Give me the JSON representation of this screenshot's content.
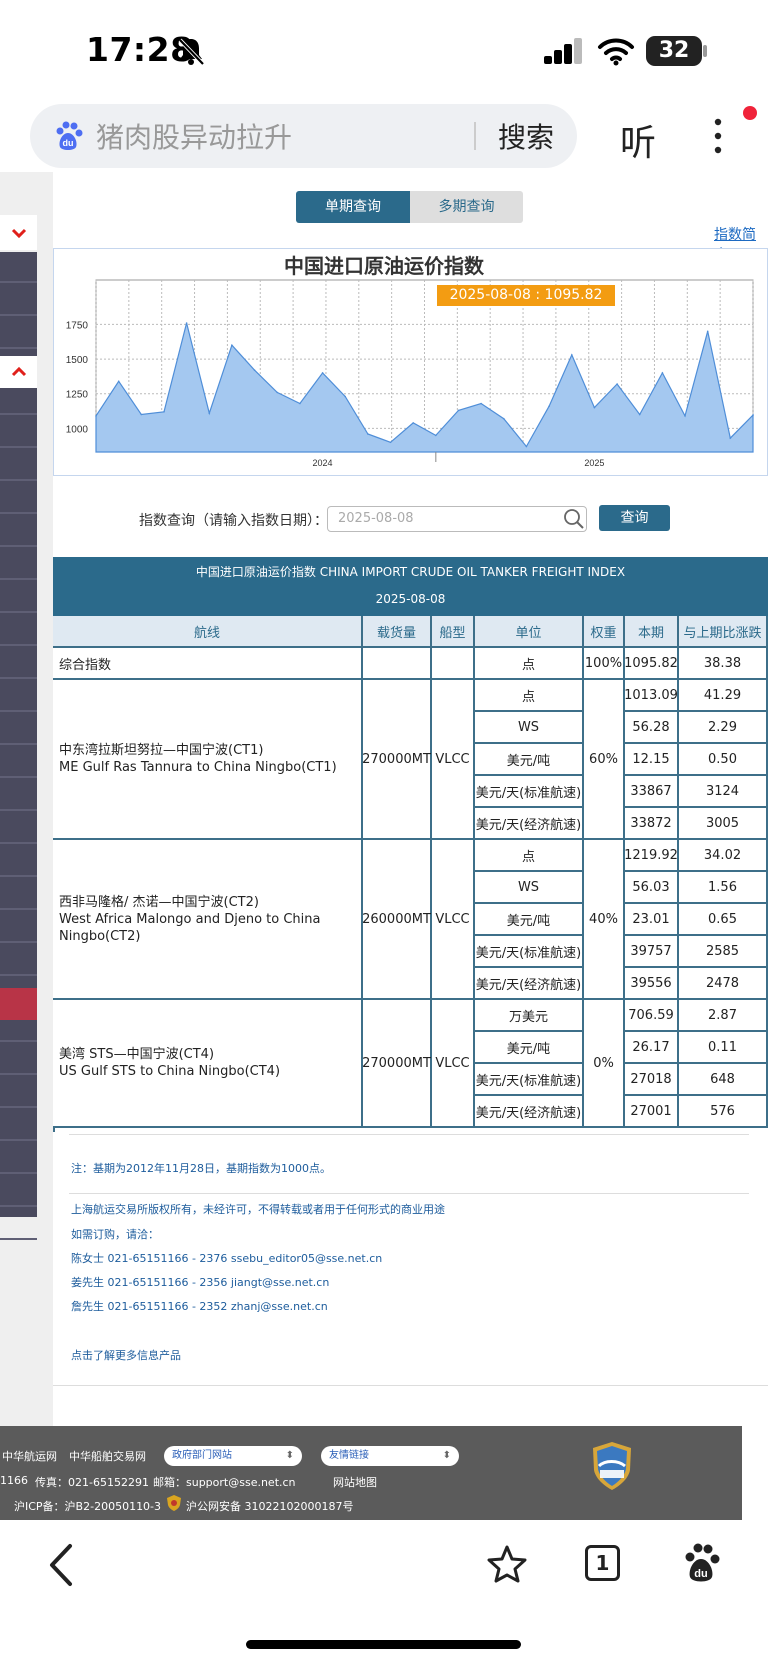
{
  "status_bar": {
    "time": "17:28",
    "battery": "32"
  },
  "search_bar": {
    "query": "猪肉股异动拉升",
    "search_label": "搜索",
    "listen_label": "听"
  },
  "tabs": {
    "single": "单期查询",
    "multi": "多期查询"
  },
  "intro_link": "指数简介",
  "chart_data": {
    "type": "area",
    "title": "中国进口原油运价指数",
    "tooltip": "2025-08-08 : 1095.82",
    "y_ticks": [
      "1750",
      "1500",
      "1250",
      "1000"
    ],
    "x_ticks": [
      "2024",
      "2025"
    ],
    "ylim": [
      830,
      2070
    ],
    "color": "#a4c8f0",
    "x": [
      "2023-03",
      "2023-04",
      "2023-05",
      "2023-06",
      "2023-07",
      "2023-08",
      "2023-09",
      "2023-10",
      "2023-11",
      "2023-12",
      "2024-01",
      "2024-02",
      "2024-03",
      "2024-04",
      "2024-05",
      "2024-06",
      "2024-07",
      "2024-08",
      "2024-09",
      "2024-10",
      "2024-11",
      "2024-12",
      "2025-01",
      "2025-02",
      "2025-03",
      "2025-04",
      "2025-05",
      "2025-06",
      "2025-07",
      "2025-08"
    ],
    "values": [
      1090,
      1340,
      1100,
      1120,
      1760,
      1110,
      1600,
      1420,
      1260,
      1180,
      1400,
      1230,
      960,
      900,
      1040,
      950,
      1130,
      1180,
      1070,
      870,
      1160,
      1530,
      1150,
      1320,
      1100,
      1400,
      1090,
      1700,
      930,
      1095.82
    ]
  },
  "query": {
    "label": "指数查询（请输入指数日期）：",
    "placeholder": "2025-08-08",
    "button": "查询"
  },
  "table": {
    "title": "中国进口原油运价指数 CHINA IMPORT CRUDE OIL TANKER FREIGHT INDEX",
    "date": "2025-08-08",
    "headers": [
      "航线",
      "载货量",
      "船型",
      "单位",
      "权重",
      "本期",
      "与上期比涨跌"
    ],
    "composite": {
      "name": "综合指数",
      "unit": "点",
      "weight": "100%",
      "current": "1095.82",
      "change": "38.38"
    },
    "routes": [
      {
        "name_cn": "中东湾拉斯坦努拉—中国宁波(CT1)",
        "name_en": "ME Gulf Ras Tannura to China Ningbo(CT1)",
        "cargo": "270000MT",
        "ship": "VLCC",
        "weight": "60%",
        "rows": [
          {
            "unit": "点",
            "current": "1013.09",
            "change": "41.29"
          },
          {
            "unit": "WS",
            "current": "56.28",
            "change": "2.29"
          },
          {
            "unit": "美元/吨",
            "current": "12.15",
            "change": "0.50"
          },
          {
            "unit": "美元/天(标准航速)",
            "current": "33867",
            "change": "3124"
          },
          {
            "unit": "美元/天(经济航速)",
            "current": "33872",
            "change": "3005"
          }
        ]
      },
      {
        "name_cn": "西非马隆格/ 杰诺—中国宁波(CT2)",
        "name_en": "West Africa Malongo and Djeno to China Ningbo(CT2)",
        "cargo": "260000MT",
        "ship": "VLCC",
        "weight": "40%",
        "rows": [
          {
            "unit": "点",
            "current": "1219.92",
            "change": "34.02"
          },
          {
            "unit": "WS",
            "current": "56.03",
            "change": "1.56"
          },
          {
            "unit": "美元/吨",
            "current": "23.01",
            "change": "0.65"
          },
          {
            "unit": "美元/天(标准航速)",
            "current": "39757",
            "change": "2585"
          },
          {
            "unit": "美元/天(经济航速)",
            "current": "39556",
            "change": "2478"
          }
        ]
      },
      {
        "name_cn": "美湾 STS—中国宁波(CT4)",
        "name_en": "US Gulf STS to China Ningbo(CT4)",
        "cargo": "270000MT",
        "ship": "VLCC",
        "weight": "0%",
        "rows": [
          {
            "unit": "万美元",
            "current": "706.59",
            "change": "2.87"
          },
          {
            "unit": "美元/吨",
            "current": "26.17",
            "change": "0.11"
          },
          {
            "unit": "美元/天(标准航速)",
            "current": "27018",
            "change": "648"
          },
          {
            "unit": "美元/天(经济航速)",
            "current": "27001",
            "change": "576"
          }
        ]
      }
    ]
  },
  "notes": {
    "base": "注：基期为2012年11月28日，基期指数为1000点。",
    "copyright": "上海航运交易所版权所有，未经许可，不得转载或者用于任何形式的商业用途",
    "subscribe": "如需订购，请洽：",
    "contact1": "陈女士 021-65151166 - 2376 ssebu_editor05@sse.net.cn",
    "contact2": "姜先生 021-65151166 - 2356 jiangt@sse.net.cn",
    "contact3": "詹先生 021-65151166 - 2352 zhanj@sse.net.cn",
    "more_link": "点击了解更多信息产品"
  },
  "footer": {
    "link1": "中华航运网",
    "link2": "中华船舶交易网",
    "select1": "政府部门网站",
    "select2": "友情链接",
    "phone": "1166",
    "fax": "传真：021-65152291",
    "email": "邮箱：support@sse.net.cn",
    "sitemap": "网站地图",
    "icp": "沪ICP备：沪B2-20050110-3",
    "police": "沪公网安备 31022102000187号"
  },
  "bottom_nav": {
    "tab_count": "1"
  }
}
